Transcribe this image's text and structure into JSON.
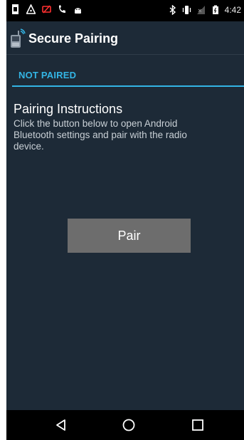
{
  "status_bar": {
    "time": "4:42",
    "icons": [
      "notification-icon",
      "warning-triangle-icon",
      "missed-call-icon",
      "phone-call-icon",
      "android-icon",
      "bluetooth-icon",
      "vibrate-icon",
      "no-signal-icon",
      "battery-icon"
    ]
  },
  "app_bar": {
    "title": "Secure Pairing",
    "icon": "radio-bluetooth-icon"
  },
  "main": {
    "status": "NOT PAIRED",
    "instructions_title": "Pairing Instructions",
    "instructions_text": "Click the button below to open Android Bluetooth settings and pair with the radio device.",
    "pair_button_label": "Pair"
  },
  "nav_bar": {
    "buttons": [
      "back-icon",
      "home-icon",
      "recents-icon"
    ]
  },
  "colors": {
    "background": "#1d2a37",
    "accent": "#33b5e5",
    "button": "#6d6d6d"
  }
}
